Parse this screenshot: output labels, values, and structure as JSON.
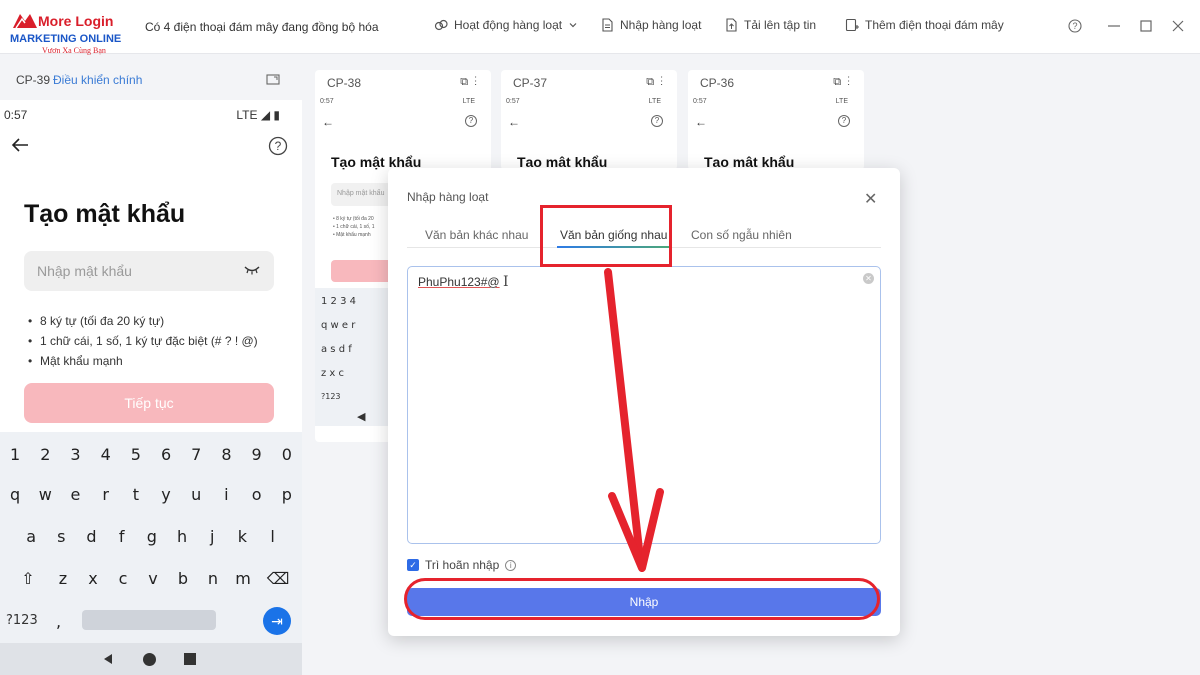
{
  "app": {
    "logo_name": "More Login",
    "logo_sub": "MARKETING ONLINE",
    "logo_slogan": "Vươn Xa Cùng Bạn",
    "sync_status": "Có 4 điện thoại đám mây đang đồng bộ hóa"
  },
  "toolbar": {
    "activity": "Hoạt động hàng loạt",
    "bulk_input": "Nhập hàng loạt",
    "upload": "Tải lên tập tin",
    "add_phone": "Thêm điện thoại đám mây"
  },
  "main_phone": {
    "id": "CP-39",
    "control_label": "Điều khiển chính",
    "time": "0:57",
    "network": "LTE",
    "title": "Tạo mật khẩu",
    "password_placeholder": "Nhập mật khẩu",
    "rules": [
      "8 ký tự (tối đa 20 ký tự)",
      "1 chữ cái, 1 số, 1 ký tự đặc biệt (# ? ! @)",
      "Mật khẩu mạnh"
    ],
    "continue_label": "Tiếp tục",
    "keyboard": {
      "row1": [
        "1",
        "2",
        "3",
        "4",
        "5",
        "6",
        "7",
        "8",
        "9",
        "0"
      ],
      "row2": [
        "q",
        "w",
        "e",
        "r",
        "t",
        "y",
        "u",
        "i",
        "o",
        "p"
      ],
      "row3": [
        "a",
        "s",
        "d",
        "f",
        "g",
        "h",
        "j",
        "k",
        "l"
      ],
      "row4": [
        "z",
        "x",
        "c",
        "v",
        "b",
        "n",
        "m"
      ],
      "symbols_key": "?123",
      "comma_key": ","
    }
  },
  "cards": [
    {
      "id": "CP-38",
      "time": "0:57",
      "network": "LTE",
      "title": "Tạo mật khẩu",
      "placeholder": "Nhập mật khẩu"
    },
    {
      "id": "CP-37",
      "time": "0:57",
      "network": "LTE",
      "title": "Tạo mật khẩu",
      "placeholder": ""
    },
    {
      "id": "CP-36",
      "time": "0:57",
      "network": "LTE",
      "title": "Tạo mật khẩu",
      "placeholder": ""
    }
  ],
  "card_keyboard": {
    "row1": "1 2 3 4",
    "row2": "q w e r",
    "row3": "a s d f",
    "row4": "z x c",
    "sym": "?123"
  },
  "modal": {
    "title": "Nhập hàng loạt",
    "tabs": [
      "Văn bản khác nhau",
      "Văn bản giống nhau",
      "Con số ngẫu nhiên"
    ],
    "active_tab": "Văn bản giống nhau",
    "text_value": "PhuPhu123#@",
    "delay_label": "Trì hoãn nhập",
    "delay_checked": true,
    "import_label": "Nhập"
  },
  "colors": {
    "accent": "#5877ea",
    "highlight": "#e5232d",
    "disabled_button": "#f8b8bd"
  }
}
